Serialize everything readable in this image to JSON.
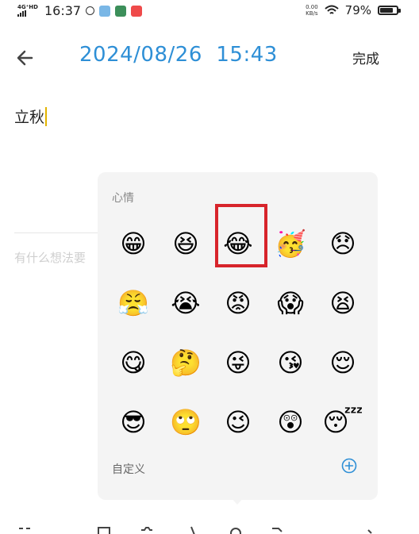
{
  "status_bar": {
    "network": "4G⁺HD",
    "time": "16:37",
    "speed_value": "0.00",
    "speed_unit": "KB/s",
    "battery_percent": "79%",
    "battery_level": 0.79
  },
  "header": {
    "back_icon": "back-arrow-icon",
    "title": "2024/08/26  15:43",
    "done_label": "完成"
  },
  "note": {
    "text": "立秋",
    "thought_placeholder": "有什么想法要"
  },
  "emoji_panel": {
    "heading": "心情",
    "emojis": [
      {
        "glyph": "😁",
        "name": "grinning-face-icon"
      },
      {
        "glyph": "😆",
        "name": "laughing-squint-icon"
      },
      {
        "glyph": "😂",
        "name": "tears-of-joy-icon",
        "selected": true
      },
      {
        "glyph": "🥳",
        "name": "party-face-icon"
      },
      {
        "glyph": "😞",
        "name": "disappointed-face-icon"
      },
      {
        "glyph": "😤",
        "name": "steam-nose-icon"
      },
      {
        "glyph": "😭",
        "name": "crying-face-icon"
      },
      {
        "glyph": "😡",
        "name": "angry-face-icon"
      },
      {
        "glyph": "😱",
        "name": "screaming-face-icon"
      },
      {
        "glyph": "😫",
        "name": "tired-face-icon"
      },
      {
        "glyph": "😋",
        "name": "yum-face-icon"
      },
      {
        "glyph": "🤔",
        "name": "thinking-face-icon"
      },
      {
        "glyph": "😜",
        "name": "winking-tongue-icon"
      },
      {
        "glyph": "😘",
        "name": "kissing-heart-icon"
      },
      {
        "glyph": "😌",
        "name": "relieved-face-icon"
      },
      {
        "glyph": "😎",
        "name": "sunglasses-face-icon"
      },
      {
        "glyph": "🙄",
        "name": "eye-roll-face-icon"
      },
      {
        "glyph": "😉",
        "name": "winking-face-icon"
      },
      {
        "glyph": "😲",
        "name": "astonished-face-icon"
      },
      {
        "glyph": "😴",
        "name": "sleeping-face-icon"
      }
    ],
    "custom_label": "自定义",
    "add_icon": "plus-circle-icon"
  },
  "colors": {
    "title_blue": "#2e8fd6",
    "selection_red": "#d7242b",
    "caret_yellow": "#e2b400",
    "panel_bg": "#f4f4f4"
  }
}
